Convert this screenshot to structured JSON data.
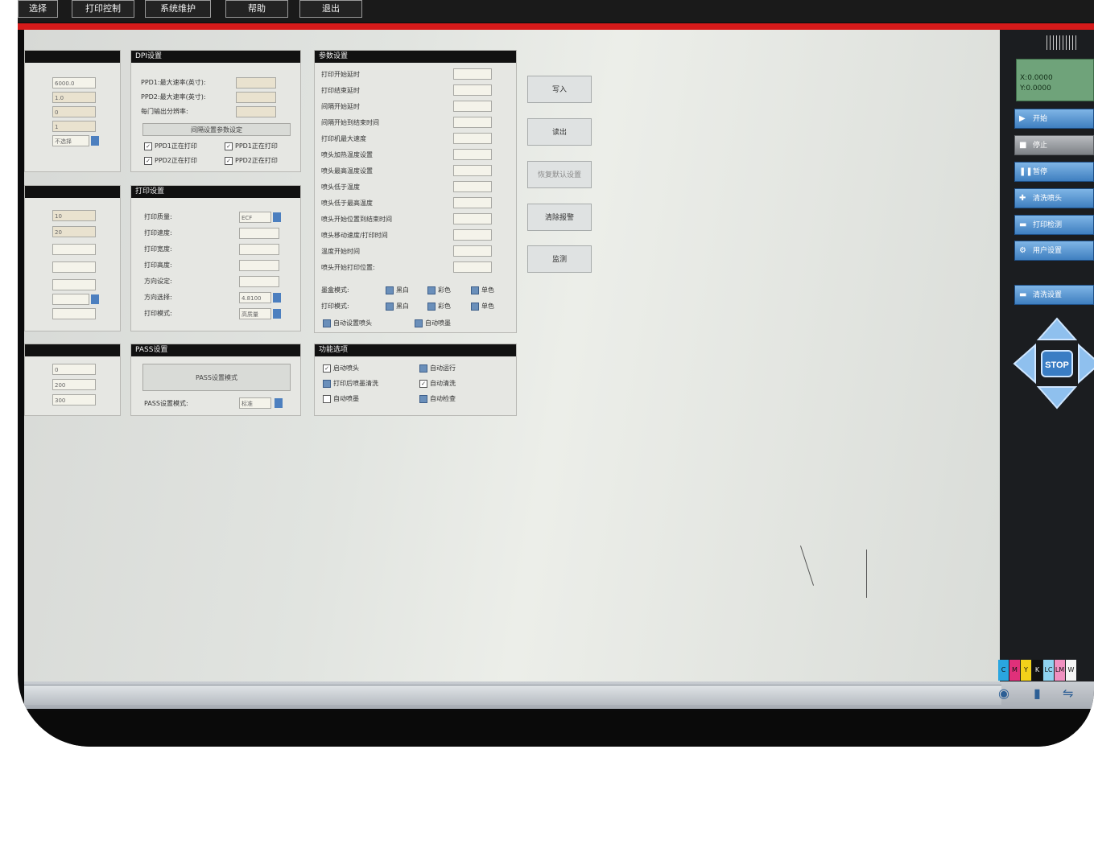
{
  "menu": {
    "items": [
      "选择",
      "打印控制",
      "系统维护",
      "帮助",
      "退出"
    ]
  },
  "panels": {
    "dpi": {
      "title": "DPI设置",
      "rows": [
        "PPD1:最大速率(英寸):",
        "PPD2:最大速率(英寸):",
        "每门输出分辨率:"
      ],
      "button": "间隔设置参数设定",
      "checks": [
        "PPD1正在打印",
        "PPD1正在打印",
        "PPD2正在打印",
        "PPD2正在打印"
      ]
    },
    "print": {
      "title": "打印设置",
      "rows": [
        "打印质量:",
        "打印速度:",
        "打印宽度:",
        "打印高度:",
        "方向设定:",
        "方向选择:",
        "打印模式:"
      ],
      "select_values": [
        "ECF",
        "4.8100",
        "高质量"
      ]
    },
    "params": {
      "title": "参数设置",
      "rows": [
        "打印开始延时",
        "打印结束延时",
        "间隔开始延时",
        "间隔开始到结束时间",
        "打印机最大速度",
        "喷头加热温度设置",
        "喷头最高温度设置",
        "喷头低于温度",
        "喷头低于最高温度",
        "喷头开始位置到结束时间",
        "喷头移动速度/打印时间",
        "温度开始时间",
        "喷头开始打印位置:"
      ],
      "left_checks_label": "墨盒模式:",
      "right_checks_label": "打印模式:",
      "mode_checks": [
        "黑白",
        "彩色",
        "单色"
      ],
      "bottom_checks": [
        "自动设置喷头",
        "自动喷墨"
      ]
    },
    "pass": {
      "title": "PASS设置",
      "button": "PASS设置模式",
      "row": "PASS设置模式:",
      "select": "标准"
    },
    "func": {
      "title": "功能选项",
      "checks": [
        "启动喷头",
        "自动运行",
        "打印后喷墨清洗",
        "自动清洗",
        "自动喷墨",
        "自动检查"
      ]
    }
  },
  "left_values": {
    "top": [
      "6000.0",
      "1.0",
      "0",
      "1"
    ],
    "mid": [
      "10",
      "20"
    ],
    "bottom": [
      "0",
      "200",
      "300"
    ],
    "select": "不选择"
  },
  "action_buttons": [
    "写入",
    "读出",
    "恢复默认设置",
    "清除报警",
    "监测"
  ],
  "sidebar": {
    "status": [
      "X:0.0000",
      "Y:0.0000"
    ],
    "buttons": [
      "开始",
      "停止",
      "暂停",
      "清洗喷头",
      "打印检测",
      "用户设置",
      "清洗设置"
    ],
    "stop": "STOP"
  },
  "color_strip": [
    "C",
    "M",
    "Y",
    "K",
    "LC",
    "LM",
    "W"
  ],
  "colors": {
    "accent_red": "#d51a1a",
    "status_green": "#6fa37a",
    "side_button_blue": "#4e8fd0"
  }
}
